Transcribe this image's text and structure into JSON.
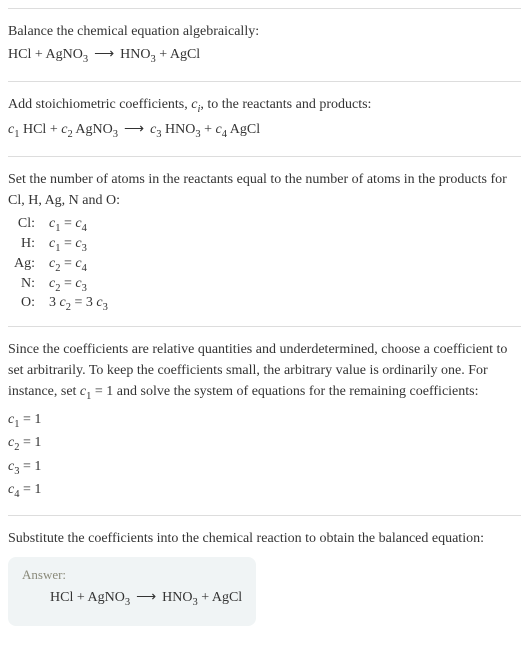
{
  "section1": {
    "intro": "Balance the chemical equation algebraically:",
    "eq_r1": "HCl",
    "plus": " + ",
    "eq_r2a": "AgNO",
    "eq_r2s": "3",
    "arrow": "⟶",
    "eq_p1a": "HNO",
    "eq_p1s": "3",
    "eq_p2": "AgCl"
  },
  "section2": {
    "intro_a": "Add stoichiometric coefficients, ",
    "ci_c": "c",
    "ci_i": "i",
    "intro_b": ", to the reactants and products:",
    "c1c": "c",
    "c1s": "1",
    "r1": " HCl",
    "plus": " + ",
    "c2c": "c",
    "c2s": "2",
    "r2a": " AgNO",
    "r2s": "3",
    "arrow": "⟶",
    "c3c": "c",
    "c3s": "3",
    "p1a": " HNO",
    "p1s": "3",
    "c4c": "c",
    "c4s": "4",
    "p2": " AgCl"
  },
  "section3": {
    "intro": "Set the number of atoms in the reactants equal to the number of atoms in the products for Cl, H, Ag, N and O:",
    "rows": [
      {
        "el": "Cl:",
        "lhs_c": "c",
        "lhs_s": "1",
        "eq": " = ",
        "rhs_c": "c",
        "rhs_s": "4"
      },
      {
        "el": "H:",
        "lhs_c": "c",
        "lhs_s": "1",
        "eq": " = ",
        "rhs_c": "c",
        "rhs_s": "3"
      },
      {
        "el": "Ag:",
        "lhs_c": "c",
        "lhs_s": "2",
        "eq": " = ",
        "rhs_c": "c",
        "rhs_s": "4"
      },
      {
        "el": "N:",
        "lhs_c": "c",
        "lhs_s": "2",
        "eq": " = ",
        "rhs_c": "c",
        "rhs_s": "3"
      }
    ],
    "o_el": "O:",
    "o_lp": "3 ",
    "o_lc": "c",
    "o_ls": "2",
    "o_eq": " = ",
    "o_rp": "3 ",
    "o_rc": "c",
    "o_rs": "3"
  },
  "section4": {
    "intro_a": "Since the coefficients are relative quantities and underdetermined, choose a coefficient to set arbitrarily. To keep the coefficients small, the arbitrary value is ordinarily one. For instance, set ",
    "set_c": "c",
    "set_s": "1",
    "set_eq": " = 1",
    "intro_b": " and solve the system of equations for the remaining coefficients:",
    "coeffs": [
      {
        "c": "c",
        "s": "1",
        "v": " = 1"
      },
      {
        "c": "c",
        "s": "2",
        "v": " = 1"
      },
      {
        "c": "c",
        "s": "3",
        "v": " = 1"
      },
      {
        "c": "c",
        "s": "4",
        "v": " = 1"
      }
    ]
  },
  "section5": {
    "intro": "Substitute the coefficients into the chemical reaction to obtain the balanced equation:",
    "answer_label": "Answer:",
    "r1": "HCl",
    "plus": " + ",
    "r2a": "AgNO",
    "r2s": "3",
    "arrow": "⟶",
    "p1a": "HNO",
    "p1s": "3",
    "p2": "AgCl"
  }
}
